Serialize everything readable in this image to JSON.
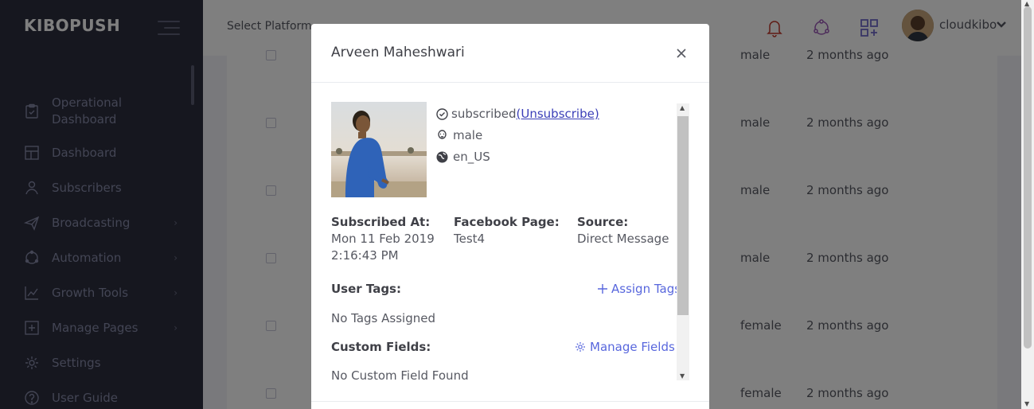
{
  "app": {
    "brand": "KIBOPUSH"
  },
  "sidebar": {
    "items": [
      {
        "label": "Operational Dashboard",
        "icon": "clipboard-icon",
        "has_submenu": false
      },
      {
        "label": "Dashboard",
        "icon": "layout-icon",
        "has_submenu": false
      },
      {
        "label": "Subscribers",
        "icon": "users-icon",
        "has_submenu": false
      },
      {
        "label": "Broadcasting",
        "icon": "paper-plane-icon",
        "has_submenu": true
      },
      {
        "label": "Automation",
        "icon": "cycle-icon",
        "has_submenu": true
      },
      {
        "label": "Growth Tools",
        "icon": "chart-line-icon",
        "has_submenu": true
      },
      {
        "label": "Manage Pages",
        "icon": "add-page-icon",
        "has_submenu": true
      },
      {
        "label": "Settings",
        "icon": "gear-icon",
        "has_submenu": false
      },
      {
        "label": "User Guide",
        "icon": "question-icon",
        "has_submenu": false
      }
    ],
    "submenu_arrow": "›"
  },
  "header": {
    "platform_label": "Select Platform",
    "user_name": "cloudkibo",
    "icons": [
      "bell-icon",
      "share-icon",
      "apps-icon"
    ]
  },
  "table": {
    "rows": [
      {
        "gender": "male",
        "subscribed": "2 months ago"
      },
      {
        "gender": "male",
        "subscribed": "2 months ago"
      },
      {
        "gender": "male",
        "subscribed": "2 months ago"
      },
      {
        "gender": "male",
        "subscribed": "2 months ago"
      },
      {
        "gender": "female",
        "subscribed": "2 months ago"
      },
      {
        "gender": "female",
        "subscribed": "2 months ago"
      }
    ]
  },
  "modal": {
    "title": "Arveen Maheshwari",
    "status": "subscribed",
    "unsubscribe_label": "(Unsubscribe)",
    "gender": "male",
    "locale": "en_US",
    "subscribed_at_label": "Subscribed At:",
    "subscribed_at_date": "Mon 11 Feb 2019",
    "subscribed_at_time": "2:16:43 PM",
    "facebook_page_label": "Facebook Page:",
    "facebook_page_value": "Test4",
    "source_label": "Source:",
    "source_value": "Direct Message",
    "user_tags_label": "User Tags:",
    "assign_tags_label": "Assign Tags",
    "no_tags_text": "No Tags Assigned",
    "custom_fields_label": "Custom Fields:",
    "manage_fields_label": "Manage Fields",
    "no_custom_fields_text": "No Custom Field Found"
  },
  "colors": {
    "sidebar_bg": "#2c2e3e",
    "accent": "#5867dd",
    "link": "#3b3fb8",
    "header_icon": "#716aca"
  }
}
